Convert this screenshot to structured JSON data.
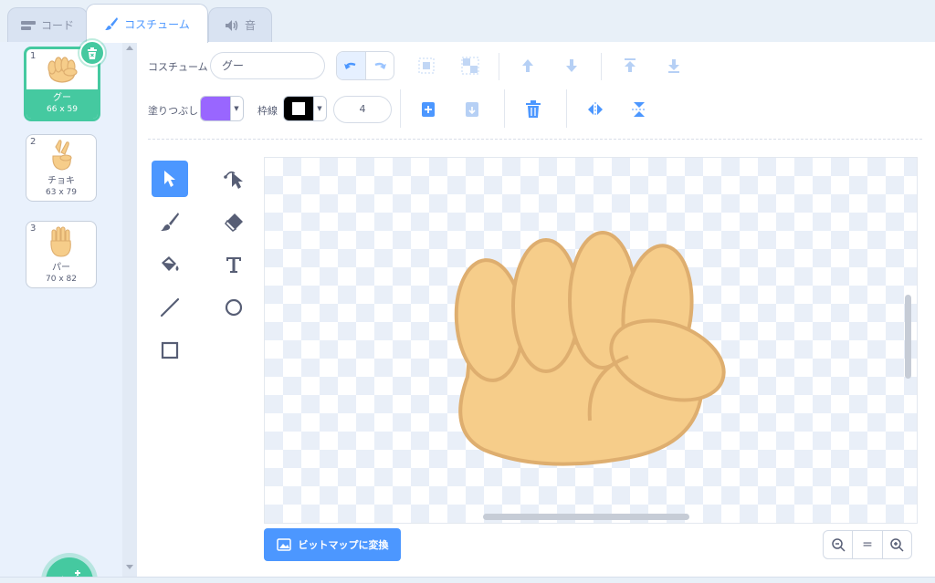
{
  "tabs": [
    {
      "label": "コード",
      "icon": "code-blocks-icon"
    },
    {
      "label": "コスチューム",
      "icon": "paintbrush-icon",
      "active": true
    },
    {
      "label": "音",
      "icon": "speaker-icon"
    }
  ],
  "costumes": [
    {
      "index": "1",
      "name": "グー",
      "size": "66 x 59",
      "selected": true
    },
    {
      "index": "2",
      "name": "チョキ",
      "size": "63 x 79"
    },
    {
      "index": "3",
      "name": "パー",
      "size": "70 x 82"
    }
  ],
  "toolbar": {
    "costume_label": "コスチューム",
    "costume_name": "グー",
    "fill_label": "塗りつぶし",
    "outline_label": "枠線",
    "stroke_width": "4",
    "fill_color": "#9966ff",
    "outline_color": "#000000"
  },
  "convert_button_label": "ビットマップに変換",
  "zoom": {
    "zoom_out": "zoom-out-icon",
    "reset": "=",
    "zoom_in": "zoom-in-icon"
  },
  "colors": {
    "accent": "#4c97ff",
    "selected": "#45c9a0",
    "hand_fill": "#f6cd8a",
    "hand_stroke": "#deae6f"
  }
}
